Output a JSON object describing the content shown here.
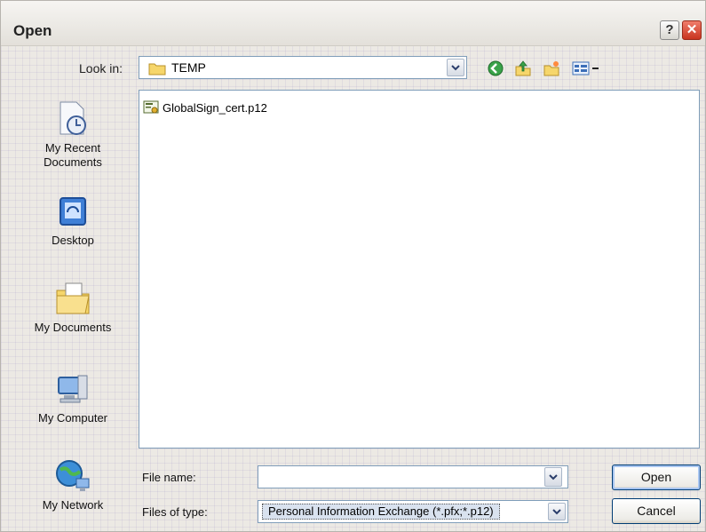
{
  "window": {
    "title": "Open",
    "help_label": "?",
    "close_label": "✕"
  },
  "lookin": {
    "label": "Look in:",
    "value": "TEMP"
  },
  "toolbar": {
    "icons": [
      "back-icon",
      "up-folder-icon",
      "new-folder-icon",
      "view-menu-icon"
    ]
  },
  "places": [
    {
      "label": "My Recent Documents",
      "icon": "recent-documents-icon"
    },
    {
      "label": "Desktop",
      "icon": "desktop-icon"
    },
    {
      "label": "My Documents",
      "icon": "my-documents-icon"
    },
    {
      "label": "My Computer",
      "icon": "my-computer-icon"
    },
    {
      "label": "My Network",
      "icon": "my-network-icon"
    }
  ],
  "files": [
    {
      "name": "GlobalSign_cert.p12",
      "icon": "certificate-file-icon"
    }
  ],
  "filename": {
    "label": "File name:",
    "value": "",
    "placeholder": ""
  },
  "filetype": {
    "label": "Files of type:",
    "value": "Personal Information Exchange (*.pfx;*.p12)"
  },
  "buttons": {
    "open": "Open",
    "cancel": "Cancel"
  },
  "colors": {
    "accent": "#316ac5",
    "border": "#7f9db9",
    "close": "#c8341f"
  }
}
